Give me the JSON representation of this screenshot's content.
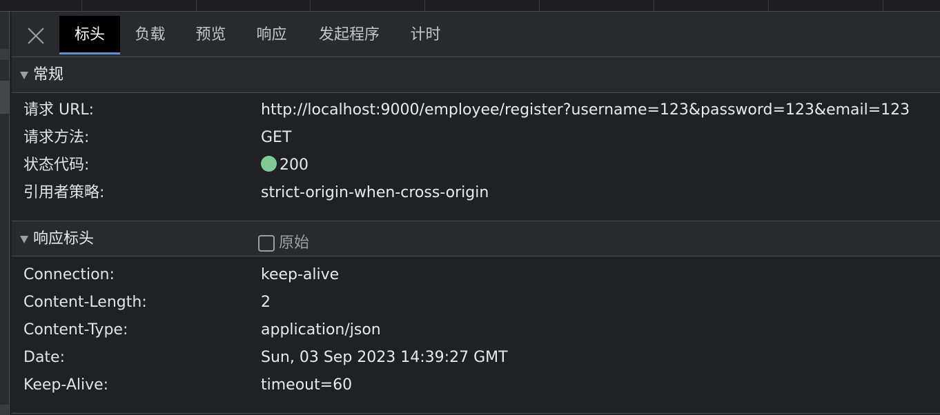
{
  "tabs": [
    {
      "label": "标头",
      "active": true
    },
    {
      "label": "负载",
      "active": false
    },
    {
      "label": "预览",
      "active": false
    },
    {
      "label": "响应",
      "active": false
    },
    {
      "label": "发起程序",
      "active": false
    },
    {
      "label": "计时",
      "active": false
    }
  ],
  "icons": {
    "close": "close-icon",
    "collapse": "triangle-down-icon"
  },
  "colors": {
    "background": "#202124",
    "header_bg": "#292a2d",
    "active_tab_bg": "#000000",
    "active_tab_underline": "#5b8fd6",
    "status_ok": "#81c995"
  },
  "general": {
    "title": "常规",
    "rows": [
      {
        "key": "请求 URL:",
        "value": "http://localhost:9000/employee/register?username=123&password=123&email=123"
      },
      {
        "key": "请求方法:",
        "value": "GET"
      },
      {
        "key": "状态代码:",
        "value": "200"
      },
      {
        "key": "引用者策略:",
        "value": "strict-origin-when-cross-origin"
      }
    ]
  },
  "response_headers": {
    "title": "响应标头",
    "raw_label": "原始",
    "raw_checked": false,
    "rows": [
      {
        "key": "Connection:",
        "value": "keep-alive"
      },
      {
        "key": "Content-Length:",
        "value": "2"
      },
      {
        "key": "Content-Type:",
        "value": "application/json"
      },
      {
        "key": "Date:",
        "value": "Sun, 03 Sep 2023 14:39:27 GMT"
      },
      {
        "key": "Keep-Alive:",
        "value": "timeout=60"
      }
    ]
  }
}
